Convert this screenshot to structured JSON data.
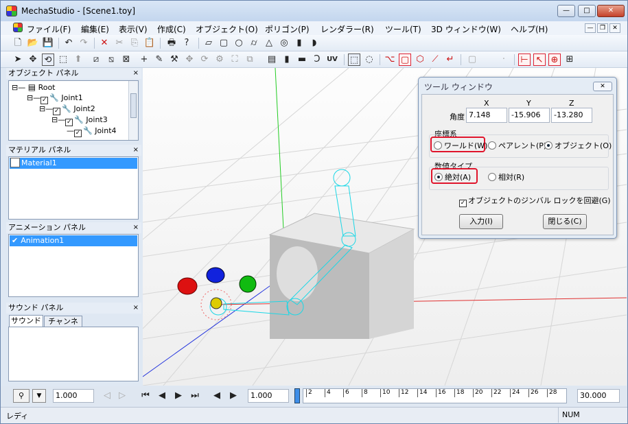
{
  "window": {
    "title": "MechaStudio - [Scene1.toy]",
    "min": "—",
    "max": "□",
    "close": "✕"
  },
  "menu": [
    "ファイル(F)",
    "編集(E)",
    "表示(V)",
    "作成(C)",
    "オブジェクト(O)",
    "ポリゴン(P)",
    "レンダラー(R)",
    "ツール(T)",
    "3D ウィンドウ(W)",
    "ヘルプ(H)"
  ],
  "mdi": {
    "min": "—",
    "restore": "❐",
    "close": "✕"
  },
  "object_panel": {
    "title": "オブジェクト パネル",
    "close": "×",
    "tree": [
      "Root",
      "Joint1",
      "Joint2",
      "Joint3",
      "Joint4"
    ]
  },
  "material_panel": {
    "title": "マテリアル パネル",
    "close": "×",
    "items": [
      "Material1"
    ]
  },
  "animation_panel": {
    "title": "アニメーション パネル",
    "close": "×",
    "items": [
      "Animation1"
    ]
  },
  "sound_panel": {
    "title": "サウンド パネル",
    "close": "×",
    "tabs": [
      "サウンド",
      "チャンネル"
    ]
  },
  "tool_window": {
    "title": "ツール ウィンドウ",
    "close": "✕",
    "axes": [
      "X",
      "Y",
      "Z"
    ],
    "angle_label": "角度",
    "angle": [
      "7.148",
      "-15.906",
      "-13.280"
    ],
    "coord_title": "座標系",
    "coord_options": [
      "ワールド(W)",
      "ペアレント(P)",
      "オブジェクト(O)"
    ],
    "value_title": "数値タイプ",
    "value_options": [
      "絶対(A)",
      "相対(R)"
    ],
    "gimbal_label": "オブジェクトのジンバル ロックを回避(G)",
    "input_button": "入力(I)",
    "close_button": "閉じる(C)"
  },
  "timeline": {
    "field1": "1.000",
    "field2": "1.000",
    "end": "30.000",
    "ticks": [
      "2",
      "4",
      "6",
      "8",
      "10",
      "12",
      "14",
      "16",
      "18",
      "20",
      "22",
      "24",
      "26",
      "28"
    ]
  },
  "status": {
    "text": "レディ",
    "num": "NUM"
  },
  "colors": {
    "highlight": "#e0142b",
    "selection": "#3399ff",
    "skeleton": "#19d7e6"
  }
}
